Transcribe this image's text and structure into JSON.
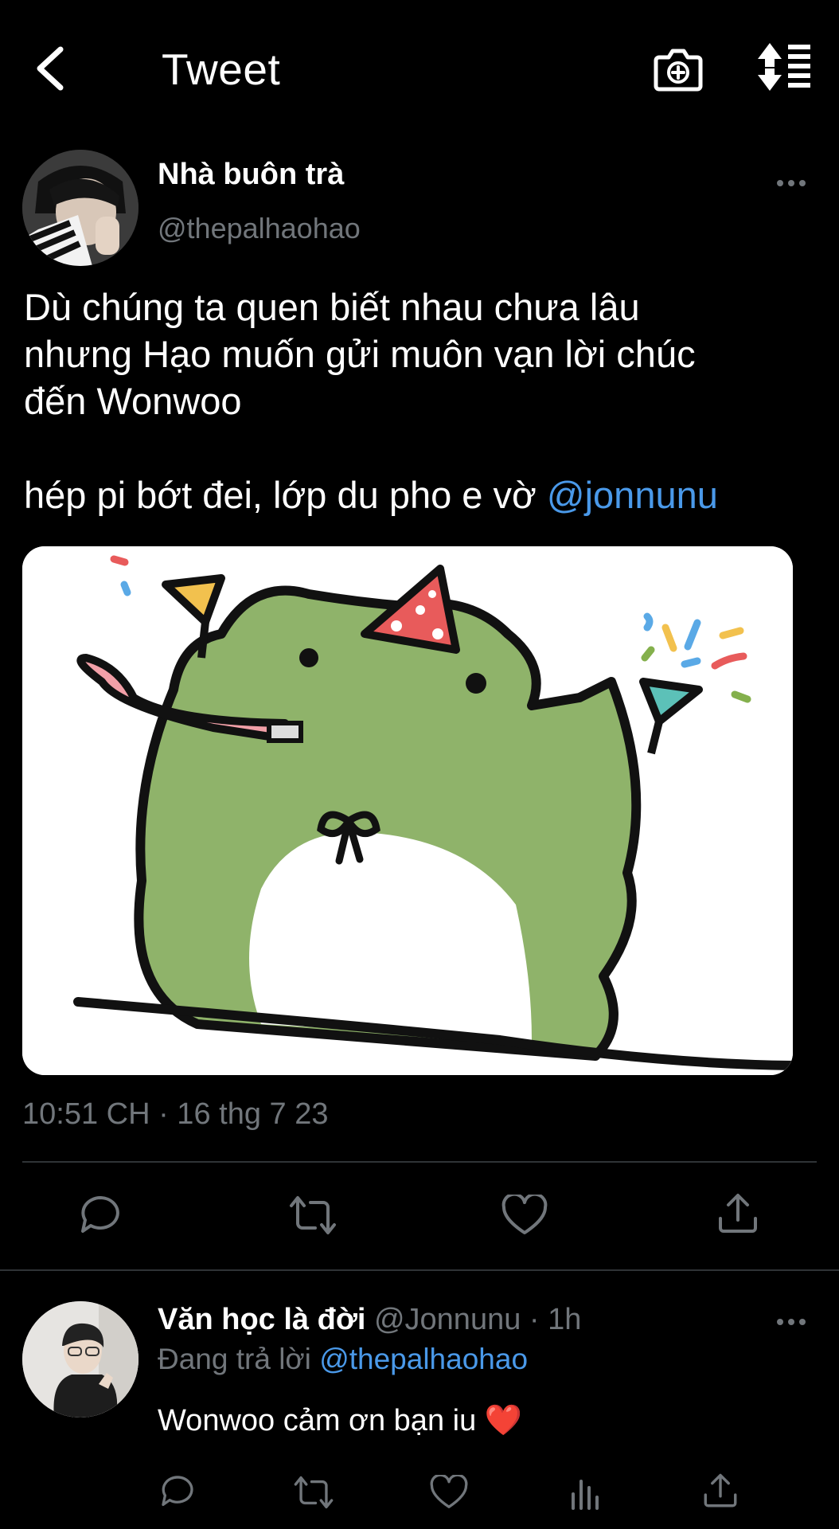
{
  "header": {
    "title": "Tweet",
    "back_icon": "chevron-left-icon",
    "camera_icon": "camera-plus-icon",
    "sort_icon": "sort-toggle-icon"
  },
  "tweet": {
    "author_name": "Nhà buôn trà",
    "author_handle": "@thepalhaohao",
    "text_lines": [
      "Dù chúng ta quen biết nhau chưa lâu",
      "nhưng Hạo muốn gửi muôn vạn lời chúc",
      "đến Wonwoo"
    ],
    "text_line4": "hép pi bớt đei, lớp du pho e vờ ",
    "mention": "@jonnunu",
    "timestamp": "10:51 CH · 16 thg 7 23",
    "actions": [
      "reply-icon",
      "retweet-icon",
      "like-icon",
      "share-icon"
    ]
  },
  "reply": {
    "author_name": "Văn học là đời",
    "meta": "@Jonnunu · 1h",
    "replying_prefix": "Đang trả lời ",
    "replying_to": "@thepalhaohao",
    "text": "Wonwoo cảm ơn bạn iu",
    "emoji": "❤️",
    "actions": [
      "reply-icon",
      "retweet-icon",
      "like-icon",
      "analytics-icon",
      "share-icon"
    ]
  },
  "colors": {
    "background": "#000000",
    "text": "#ffffff",
    "secondary": "#71767b",
    "link": "#4a99e9",
    "divider": "#2f3336"
  }
}
